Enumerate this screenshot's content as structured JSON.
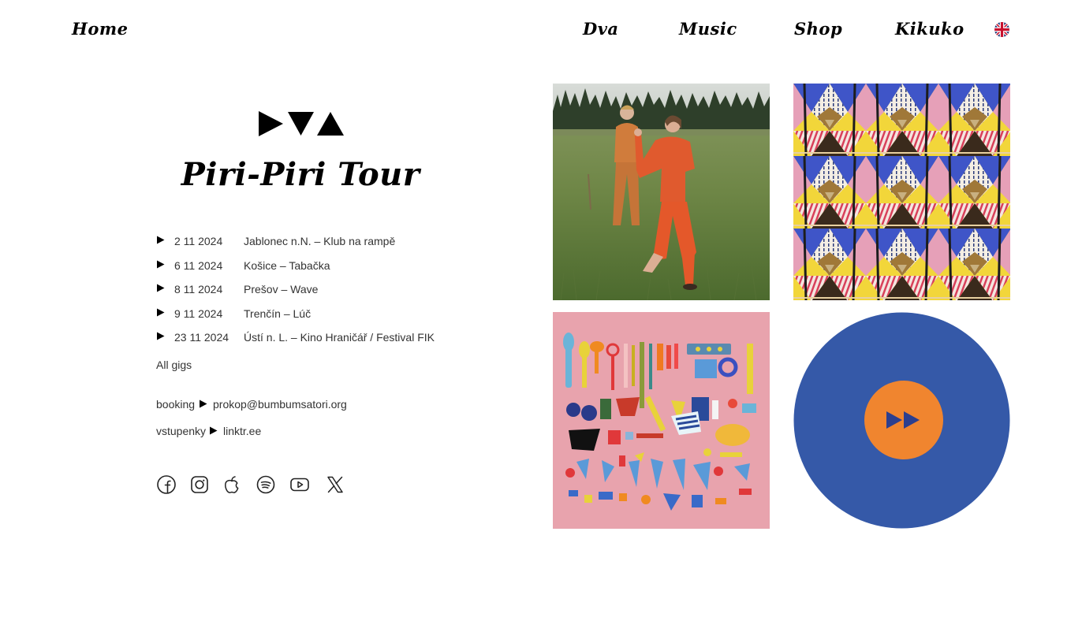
{
  "nav": {
    "home": "Home",
    "dva": "Dva",
    "music": "Music",
    "shop": "Shop",
    "kikuko": "Kikuko",
    "language_icon": "uk-flag-icon"
  },
  "hero": {
    "logo_icon": "dva-triangles-logo",
    "title": "Piri-Piri Tour"
  },
  "gigs": [
    {
      "date": "2 11 2024",
      "venue": "Jablonec n.N. – Klub na rampě"
    },
    {
      "date": "6 11 2024",
      "venue": "Košice – Tabačka"
    },
    {
      "date": "8 11 2024",
      "venue": "Prešov – Wave"
    },
    {
      "date": "9 11 2024",
      "venue": "Trenčín – Lúč"
    },
    {
      "date": "23 11 2024",
      "venue": "Ústí n. L. – Kino Hraničář / Festival FIK"
    }
  ],
  "all_gigs": "All gigs",
  "contacts": {
    "booking_label": "booking",
    "booking_value": "prokop@bumbumsatori.org",
    "tickets_label": "vstupenky",
    "tickets_value": "linktr.ee"
  },
  "social": [
    "facebook-icon",
    "instagram-icon",
    "apple-icon",
    "spotify-icon",
    "youtube-icon",
    "x-icon"
  ],
  "colors": {
    "vinyl_blue": "#3559a8",
    "vinyl_label_orange": "#f0852f",
    "pink_background": "#e8a3ad"
  }
}
